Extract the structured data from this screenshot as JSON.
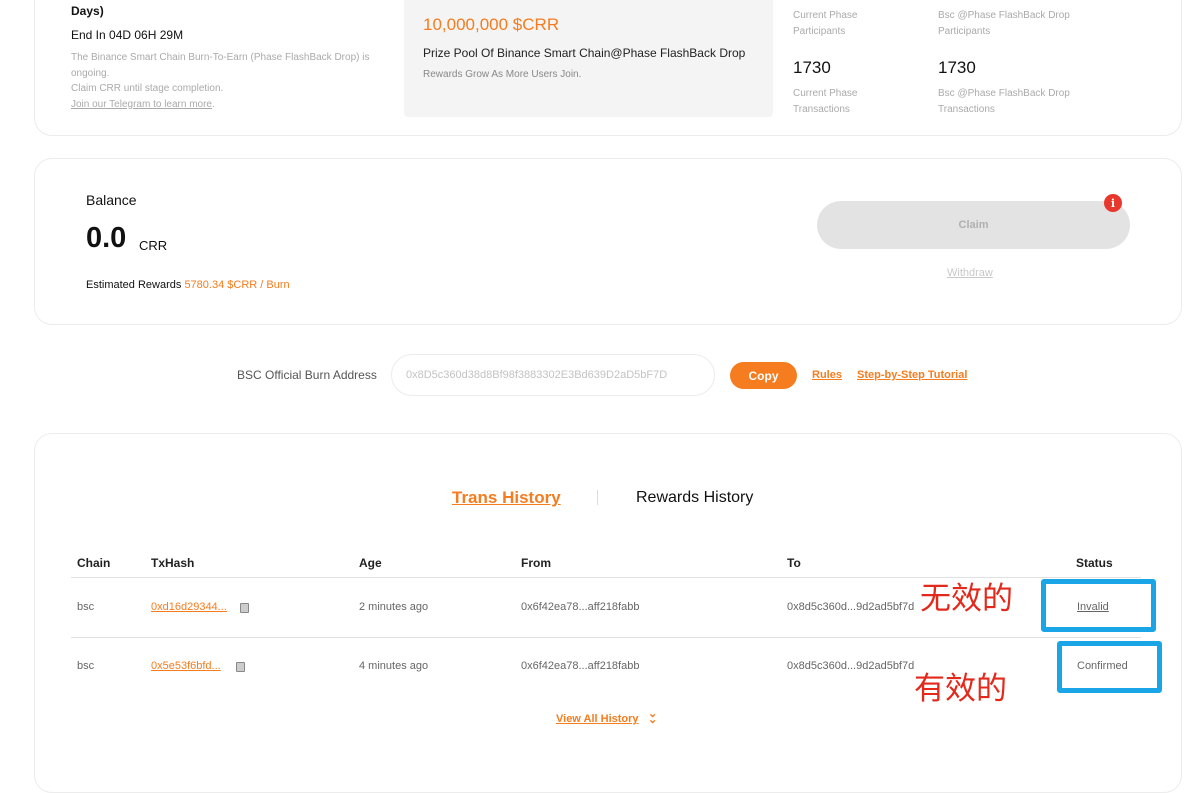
{
  "top": {
    "days": "Days)",
    "end_in": "End In 04D 06H 29M",
    "desc_line1": "The Binance Smart Chain Burn-To-Earn (Phase FlashBack Drop) is ongoing.",
    "desc_line2": "Claim CRR until stage completion.",
    "telegram_link": "Join our Telegram to learn more",
    "telegram_suffix": ".",
    "prize_amount": "10,000,000 $CRR",
    "prize_pool": "Prize Pool Of Binance Smart Chain@Phase FlashBack Drop",
    "rewards_grow": "Rewards Grow As More Users Join.",
    "stats": {
      "current_participants_label": "Current Phase Participants",
      "bsc_participants_label": "Bsc @Phase FlashBack Drop Participants",
      "current_tx_value": "1730",
      "bsc_tx_value": "1730",
      "current_tx_label": "Current Phase Transactions",
      "bsc_tx_label": "Bsc @Phase FlashBack Drop Transactions"
    }
  },
  "balance": {
    "title": "Balance",
    "value": "0.0",
    "unit": "CRR",
    "est_label": "Estimated Rewards ",
    "est_value": "5780.34 $CRR / Burn",
    "claim_label": "Claim",
    "info_glyph": "i",
    "withdraw_label": "Withdraw"
  },
  "address": {
    "label": "BSC Official Burn Address",
    "value": "0x8D5c360d38d8Bf98f3883302E3Bd639D2aD5bF7D",
    "copy_label": "Copy",
    "rules_label": "Rules",
    "tutorial_label": "Step-by-Step Tutorial"
  },
  "history": {
    "tab_trans": "Trans History",
    "tab_rewards": "Rewards History",
    "headers": {
      "chain": "Chain",
      "txhash": "TxHash",
      "age": "Age",
      "from": "From",
      "to": "To",
      "status": "Status"
    },
    "rows": [
      {
        "chain": "bsc",
        "txhash": "0xd16d29344...",
        "age": "2 minutes ago",
        "from": "0x6f42ea78...aff218fabb",
        "to": "0x8d5c360d...9d2ad5bf7d",
        "status": "Invalid"
      },
      {
        "chain": "bsc",
        "txhash": "0x5e53f6bfd...",
        "age": "4 minutes ago",
        "from": "0x6f42ea78...aff218fabb",
        "to": "0x8d5c360d...9d2ad5bf7d",
        "status": "Confirmed"
      }
    ],
    "view_all": "View All History",
    "annotations": {
      "invalid": "无效的",
      "valid": "有效的"
    }
  },
  "colors": {
    "accent": "#f57c1f",
    "highlight": "#1aa6e6",
    "annotation": "#e3281c",
    "info": "#e8372c"
  }
}
